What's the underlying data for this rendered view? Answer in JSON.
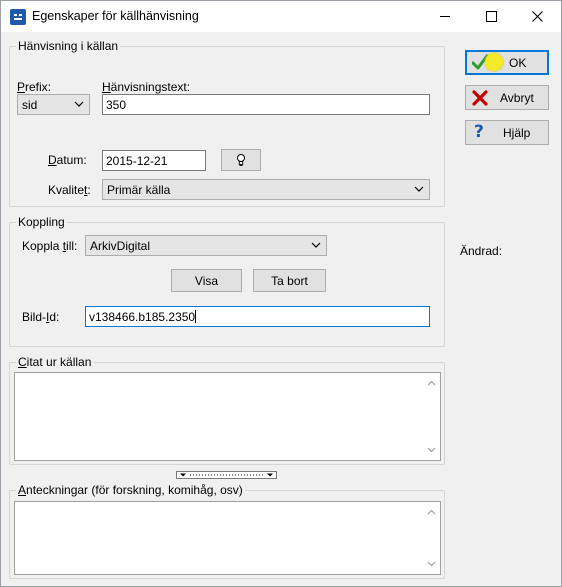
{
  "window": {
    "title": "Egenskaper för källhänvisning"
  },
  "reference_group": {
    "title": "Hänvisning i källan",
    "prefix_label": "Prefix:",
    "prefix_value": "sid",
    "reference_text_label": "Hänvisningstext:",
    "reference_text_value": "350",
    "date_label": "Datum:",
    "date_value": "2015-12-21",
    "quality_label": "Kvalitet:",
    "quality_value": "Primär källa"
  },
  "link_group": {
    "title": "Koppling",
    "link_to_label": "Koppla till:",
    "link_to_value": "ArkivDigital",
    "show_button": "Visa",
    "remove_button": "Ta bort",
    "image_id_label": "Bild-Id:",
    "image_id_value": "v138466.b185.2350"
  },
  "quote_group": {
    "title": "Citat ur källan"
  },
  "notes_group": {
    "title": "Anteckningar (för forskning, komihåg, osv)"
  },
  "buttons": {
    "ok": "OK",
    "cancel": "Avbryt",
    "help": "Hjälp"
  },
  "changed_label": "Ändrad:",
  "colors": {
    "accent": "#0078d7",
    "ok_check": "#2e9b2e",
    "cancel_x": "#c00000",
    "help_q": "#1e5aa8",
    "cursor_highlight": "#f3ea29"
  }
}
